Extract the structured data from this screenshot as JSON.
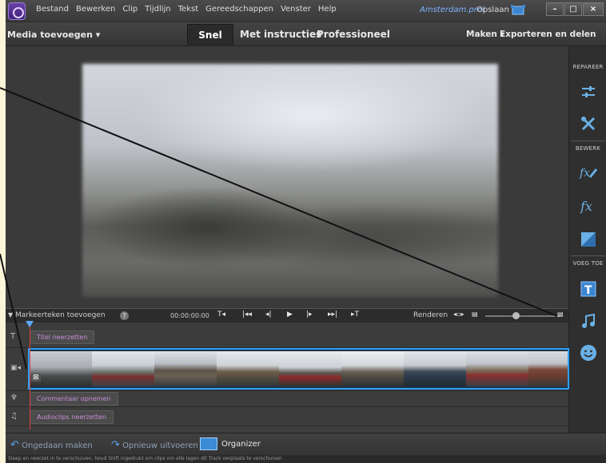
{
  "menu": {
    "items": [
      "Bestand",
      "Bewerken",
      "Clip",
      "Tijdlijn",
      "Tekst",
      "Gereedschappen",
      "Venster",
      "Help"
    ],
    "project": "Amsterdam.prel",
    "save": "Opslaan"
  },
  "window": {
    "minimize": "–",
    "maximize": "□",
    "close": "×"
  },
  "modebar": {
    "media_add": "Media toevoegen ▾",
    "tab_quick": "Snel",
    "tab_guided": "Met instructies",
    "tab_expert": "Professioneel",
    "create": "Maken ▾",
    "export": "Exporteren en delen"
  },
  "right_panel": {
    "repair": "REPAREER",
    "edit": "BEWERK",
    "add": "VOEG TOE",
    "icons": [
      "adjust-icon",
      "tools-icon",
      "fx-pen-icon",
      "fx-icon",
      "transition-icon",
      "title-icon",
      "music-icon",
      "smiley-icon"
    ]
  },
  "timeline": {
    "marker_add": "Markeerteken toevoegen",
    "help": "?",
    "timecode": "00:00:00:00",
    "render": "Renderen",
    "zoom_level": 0.4
  },
  "tracks": {
    "title": "Titel neerzetten",
    "narration": "Commentaar opnemen",
    "audio": "Audioclips neerzetten"
  },
  "bottombar": {
    "undo": "Ongedaan maken",
    "redo": "Opnieuw uitvoeren",
    "organizer": "Organizer"
  },
  "status": "Sleep en neerzet in te verschuiven, houd Shift ingedrukt om clips om alle lagen dit Track verplaats te verschuiven",
  "colors": {
    "accent": "#2aa0ff",
    "playhead": "#e04040",
    "track_label": "#c78fd8",
    "panel_icon": "#6ab0e6"
  }
}
